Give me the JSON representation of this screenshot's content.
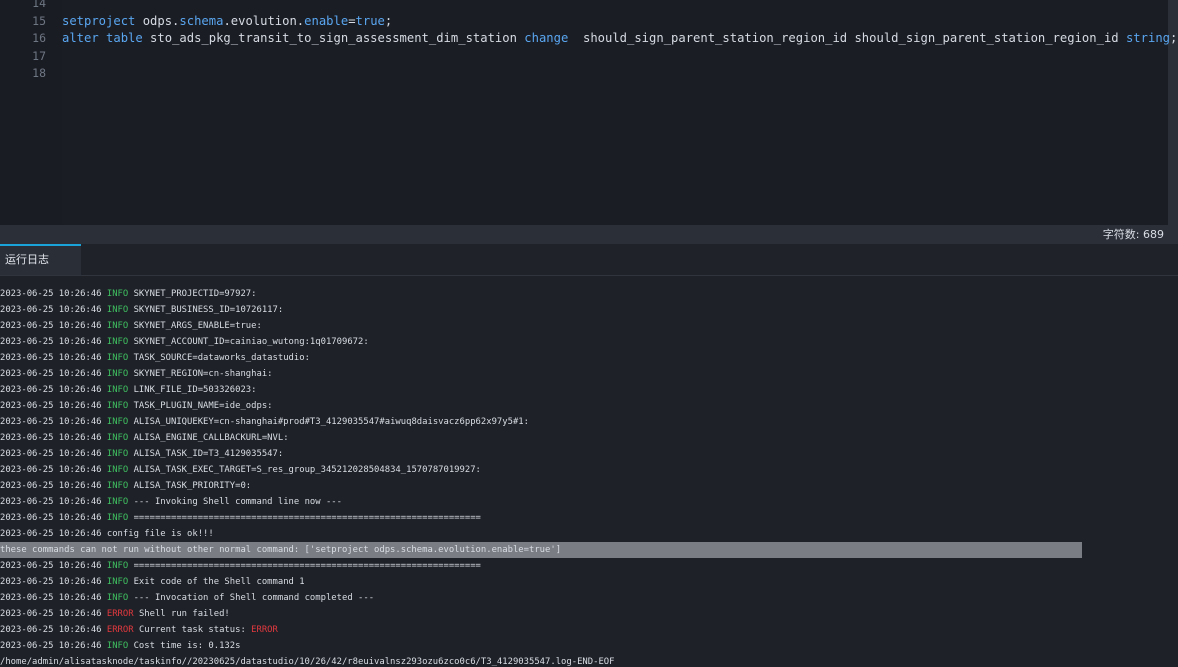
{
  "editor": {
    "lines": [
      {
        "num": "14",
        "tokens": []
      },
      {
        "num": "15",
        "tokens": [
          {
            "t": "setproject",
            "k": "kw"
          },
          {
            "t": " odps.",
            "k": "tx"
          },
          {
            "t": "schema",
            "k": "kw"
          },
          {
            "t": ".evolution.",
            "k": "tx"
          },
          {
            "t": "enable",
            "k": "kw"
          },
          {
            "t": "=",
            "k": "tx"
          },
          {
            "t": "true",
            "k": "kw"
          },
          {
            "t": ";",
            "k": "tx"
          }
        ]
      },
      {
        "num": "16",
        "tokens": [
          {
            "t": "alter",
            "k": "kw"
          },
          {
            "t": " ",
            "k": "tx"
          },
          {
            "t": "table",
            "k": "kw"
          },
          {
            "t": " sto_ads_pkg_transit_to_sign_assessment_dim_station ",
            "k": "tx"
          },
          {
            "t": "change",
            "k": "kw"
          },
          {
            "t": "  should_sign_parent_station_region_id should_sign_parent_station_region_id ",
            "k": "tx"
          },
          {
            "t": "string",
            "k": "kw"
          },
          {
            "t": ";",
            "k": "tx"
          }
        ]
      },
      {
        "num": "17",
        "tokens": []
      },
      {
        "num": "18",
        "tokens": []
      }
    ]
  },
  "statusbar": {
    "char_count_label": "字符数: ",
    "char_count_value": "689"
  },
  "tabs": [
    {
      "label": "运行日志",
      "active": true
    }
  ],
  "log": {
    "rows": [
      {
        "ts": "2023-06-25 10:26:46",
        "level": "INFO",
        "msg": "SKYNET_PROJECTID=97927:"
      },
      {
        "ts": "2023-06-25 10:26:46",
        "level": "INFO",
        "msg": "SKYNET_BUSINESS_ID=10726117:"
      },
      {
        "ts": "2023-06-25 10:26:46",
        "level": "INFO",
        "msg": "SKYNET_ARGS_ENABLE=true:"
      },
      {
        "ts": "2023-06-25 10:26:46",
        "level": "INFO",
        "msg": "SKYNET_ACCOUNT_ID=cainiao_wutong:1q01709672:"
      },
      {
        "ts": "2023-06-25 10:26:46",
        "level": "INFO",
        "msg": "TASK_SOURCE=dataworks_datastudio:"
      },
      {
        "ts": "2023-06-25 10:26:46",
        "level": "INFO",
        "msg": "SKYNET_REGION=cn-shanghai:"
      },
      {
        "ts": "2023-06-25 10:26:46",
        "level": "INFO",
        "msg": "LINK_FILE_ID=503326023:"
      },
      {
        "ts": "2023-06-25 10:26:46",
        "level": "INFO",
        "msg": "TASK_PLUGIN_NAME=ide_odps:"
      },
      {
        "ts": "2023-06-25 10:26:46",
        "level": "INFO",
        "msg": "ALISA_UNIQUEKEY=cn-shanghai#prod#T3_4129035547#aiwuq8daisvacz6pp62x97y5#1:"
      },
      {
        "ts": "2023-06-25 10:26:46",
        "level": "INFO",
        "msg": "ALISA_ENGINE_CALLBACKURL=NVL:"
      },
      {
        "ts": "2023-06-25 10:26:46",
        "level": "INFO",
        "msg": "ALISA_TASK_ID=T3_4129035547:"
      },
      {
        "ts": "2023-06-25 10:26:46",
        "level": "INFO",
        "msg": "ALISA_TASK_EXEC_TARGET=S_res_group_345212028504834_1570787019927:"
      },
      {
        "ts": "2023-06-25 10:26:46",
        "level": "INFO",
        "msg": "ALISA_TASK_PRIORITY=0:"
      },
      {
        "ts": "2023-06-25 10:26:46",
        "level": "INFO",
        "msg": "--- Invoking Shell command line now ---"
      },
      {
        "ts": "2023-06-25 10:26:46",
        "level": "INFO",
        "msg": "================================================================="
      },
      {
        "ts": "2023-06-25 10:26:46",
        "level": "",
        "msg": "config file is ok!!!"
      },
      {
        "ts": "",
        "level": "",
        "msg": "these commands can not run without other normal command: ['setproject odps.schema.evolution.enable=true']",
        "highlight": true
      },
      {
        "ts": "2023-06-25 10:26:46",
        "level": "INFO",
        "msg": "================================================================="
      },
      {
        "ts": "2023-06-25 10:26:46",
        "level": "INFO",
        "msg": "Exit code of the Shell command 1"
      },
      {
        "ts": "2023-06-25 10:26:46",
        "level": "INFO",
        "msg": "--- Invocation of Shell command completed ---"
      },
      {
        "ts": "2023-06-25 10:26:46",
        "level": "ERROR",
        "msg": "Shell run failed!"
      },
      {
        "ts": "2023-06-25 10:26:46",
        "level": "ERROR",
        "msg": "Current task status: ",
        "msg_red": "ERROR"
      },
      {
        "ts": "2023-06-25 10:26:46",
        "level": "INFO",
        "msg": "Cost time is: 0.132s"
      },
      {
        "ts": "",
        "level": "",
        "msg": "/home/admin/alisatasknode/taskinfo//20230625/datastudio/10/26/42/r8euivalnsz293ozu6zco0c6/T3_4129035547.log-END-EOF"
      }
    ]
  }
}
